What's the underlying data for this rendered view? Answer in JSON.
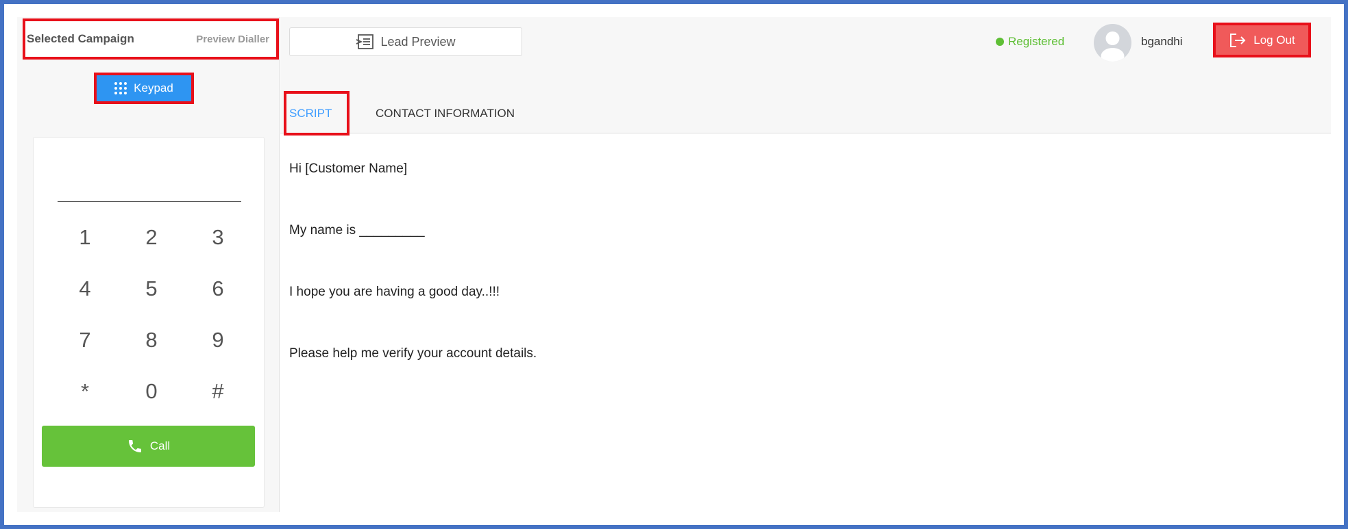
{
  "sidebar": {
    "campaign_title": "Selected Campaign",
    "campaign_mode": "Preview Dialler",
    "keypad_label": "Keypad",
    "dial_value": "",
    "keys": [
      [
        "1",
        "2",
        "3"
      ],
      [
        "4",
        "5",
        "6"
      ],
      [
        "7",
        "8",
        "9"
      ],
      [
        "*",
        "0",
        "#"
      ]
    ],
    "call_label": "Call"
  },
  "header": {
    "lead_preview_label": "Lead Preview",
    "status_text": "Registered",
    "username": "bgandhi",
    "logout_label": "Log Out"
  },
  "tabs": [
    {
      "label": "SCRIPT",
      "active": true
    },
    {
      "label": "CONTACT INFORMATION",
      "active": false
    }
  ],
  "script_lines": [
    "Hi [Customer Name]",
    "My name is _________",
    "I hope you are having a good day..!!!",
    "Please help me verify your account details."
  ],
  "colors": {
    "accent_blue": "#409eff",
    "call_green": "#66c23a",
    "logout_red": "#f05a5a",
    "status_green": "#5fbf36"
  }
}
